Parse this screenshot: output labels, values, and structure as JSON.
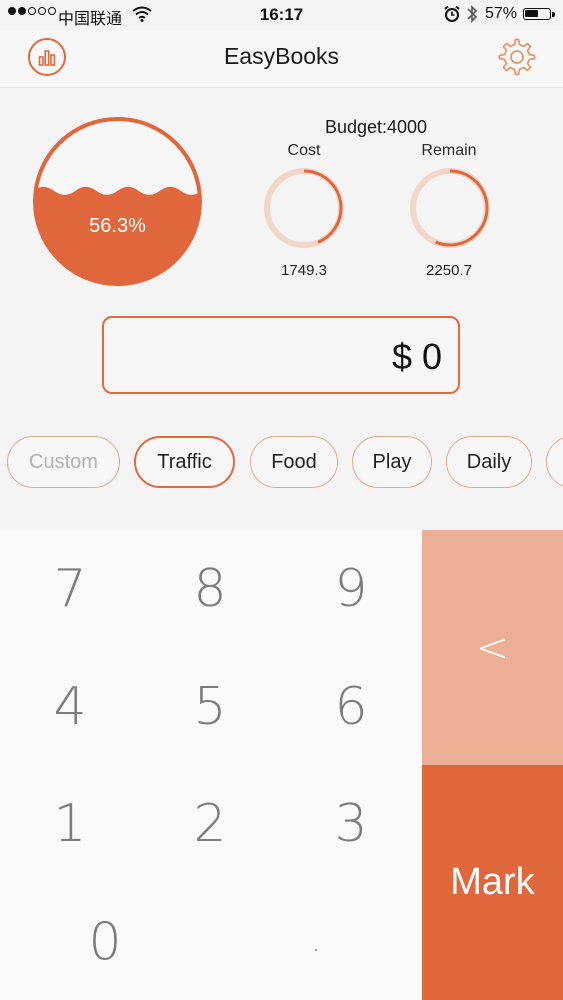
{
  "status_bar": {
    "carrier": "中国联通",
    "time": "16:17",
    "battery": "57%",
    "battery_level": 0.57,
    "signal_bars": 2,
    "signal_total": 5
  },
  "header": {
    "title": "EasyBooks",
    "left_icon": "bar-chart-icon",
    "right_icon": "gear-icon"
  },
  "summary": {
    "percent_label": "56.3%",
    "fill_fraction": 0.563,
    "budget_label": "Budget:4000",
    "cost": {
      "label": "Cost",
      "value": "1749.3",
      "fraction": 0.437
    },
    "remain": {
      "label": "Remain",
      "value": "2250.7",
      "fraction": 0.563
    }
  },
  "amount": {
    "display": "$ 0"
  },
  "categories": [
    {
      "label": "Custom",
      "state": "muted"
    },
    {
      "label": "Traffic",
      "state": "active"
    },
    {
      "label": "Food",
      "state": "normal"
    },
    {
      "label": "Play",
      "state": "normal"
    },
    {
      "label": "Daily",
      "state": "normal"
    },
    {
      "label": "",
      "state": "normal"
    }
  ],
  "keypad": {
    "keys": [
      "7",
      "8",
      "9",
      "4",
      "5",
      "6",
      "1",
      "2",
      "3",
      "0",
      "."
    ],
    "back_label": "<",
    "mark_label": "Mark"
  },
  "colors": {
    "accent": "#e0663c",
    "accent_light": "#eaaf94",
    "ring_track": "#f2d6c9"
  }
}
